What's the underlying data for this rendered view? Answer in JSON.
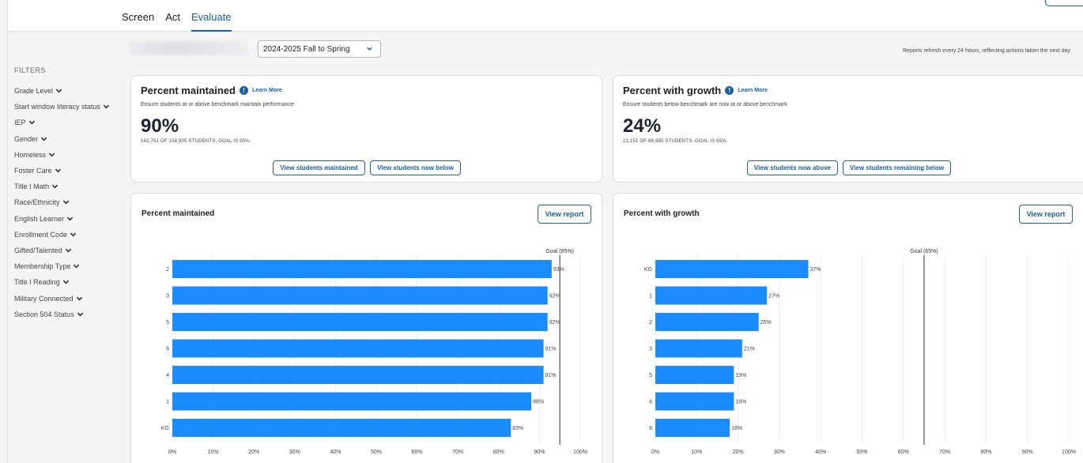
{
  "tabs": [
    {
      "label": "Screen",
      "active": false
    },
    {
      "label": "Act",
      "active": false
    },
    {
      "label": "Evaluate",
      "active": true
    }
  ],
  "filters": {
    "title": "FILTERS",
    "items": [
      "Grade Level",
      "Start window literacy status",
      "IEP",
      "Gender",
      "Homeless",
      "Foster Care",
      "Title I Math",
      "Race/Ethnicity",
      "English Learner",
      "Enrollment Code",
      "Gifted/Talented",
      "Membership Type",
      "Title I Reading",
      "Military Connected",
      "Section 504 Status"
    ]
  },
  "period_select": {
    "value": "2024-2025 Fall to Spring"
  },
  "refresh_note": "Reports refresh every 24 hours, reflecting actions taken the next day",
  "kpi_maintained": {
    "title": "Percent maintained",
    "learn_more": "Learn More",
    "description": "Ensure students at or above benchmark maintain performance",
    "value": "90%",
    "subtext": "142,751 OF 158,905 STUDENTS. GOAL IS 95%.",
    "button_primary": "View students maintained",
    "button_secondary": "View students now below"
  },
  "kpi_growth": {
    "title": "Percent with growth",
    "learn_more": "Learn More",
    "description": "Ensure students below benchmark are now at or above benchmark",
    "value": "24%",
    "subtext": "21,151 OF 88,985 STUDENTS. GOAL IS 65%.",
    "button_primary": "View students now above",
    "button_secondary": "View students remaining below"
  },
  "charts": {
    "maintained": {
      "title": "Percent maintained",
      "report_label": "View report"
    },
    "growth": {
      "title": "Percent with growth",
      "report_label": "View report"
    }
  },
  "colors": {
    "accent": "#1a5fa8",
    "bar": "#1a8cff",
    "goal_line": "#555555"
  },
  "chart_data": [
    {
      "type": "bar",
      "orientation": "horizontal",
      "title": "Percent maintained",
      "categories": [
        "2",
        "3",
        "5",
        "6",
        "4",
        "1",
        "KG"
      ],
      "values": [
        93,
        92,
        92,
        91,
        91,
        88,
        83
      ],
      "value_labels": [
        "93%",
        "92%",
        "92%",
        "91%",
        "91%",
        "88%",
        "83%"
      ],
      "goal": {
        "value": 95,
        "label": "Goal (95%)"
      },
      "xlim": [
        0,
        100
      ],
      "xticks": [
        "0%",
        "10%",
        "20%",
        "30%",
        "40%",
        "50%",
        "60%",
        "70%",
        "80%",
        "90%",
        "100%"
      ],
      "grid": true
    },
    {
      "type": "bar",
      "orientation": "horizontal",
      "title": "Percent with growth",
      "categories": [
        "KG",
        "1",
        "2",
        "3",
        "5",
        "4",
        "6"
      ],
      "values": [
        37,
        27,
        25,
        21,
        19,
        19,
        18
      ],
      "value_labels": [
        "37%",
        "27%",
        "25%",
        "21%",
        "19%",
        "19%",
        "18%"
      ],
      "goal": {
        "value": 65,
        "label": "Goal (65%)"
      },
      "xlim": [
        0,
        100
      ],
      "xticks": [
        "0%",
        "10%",
        "20%",
        "30%",
        "40%",
        "50%",
        "60%",
        "70%",
        "80%",
        "90%",
        "100%"
      ],
      "grid": true
    }
  ]
}
